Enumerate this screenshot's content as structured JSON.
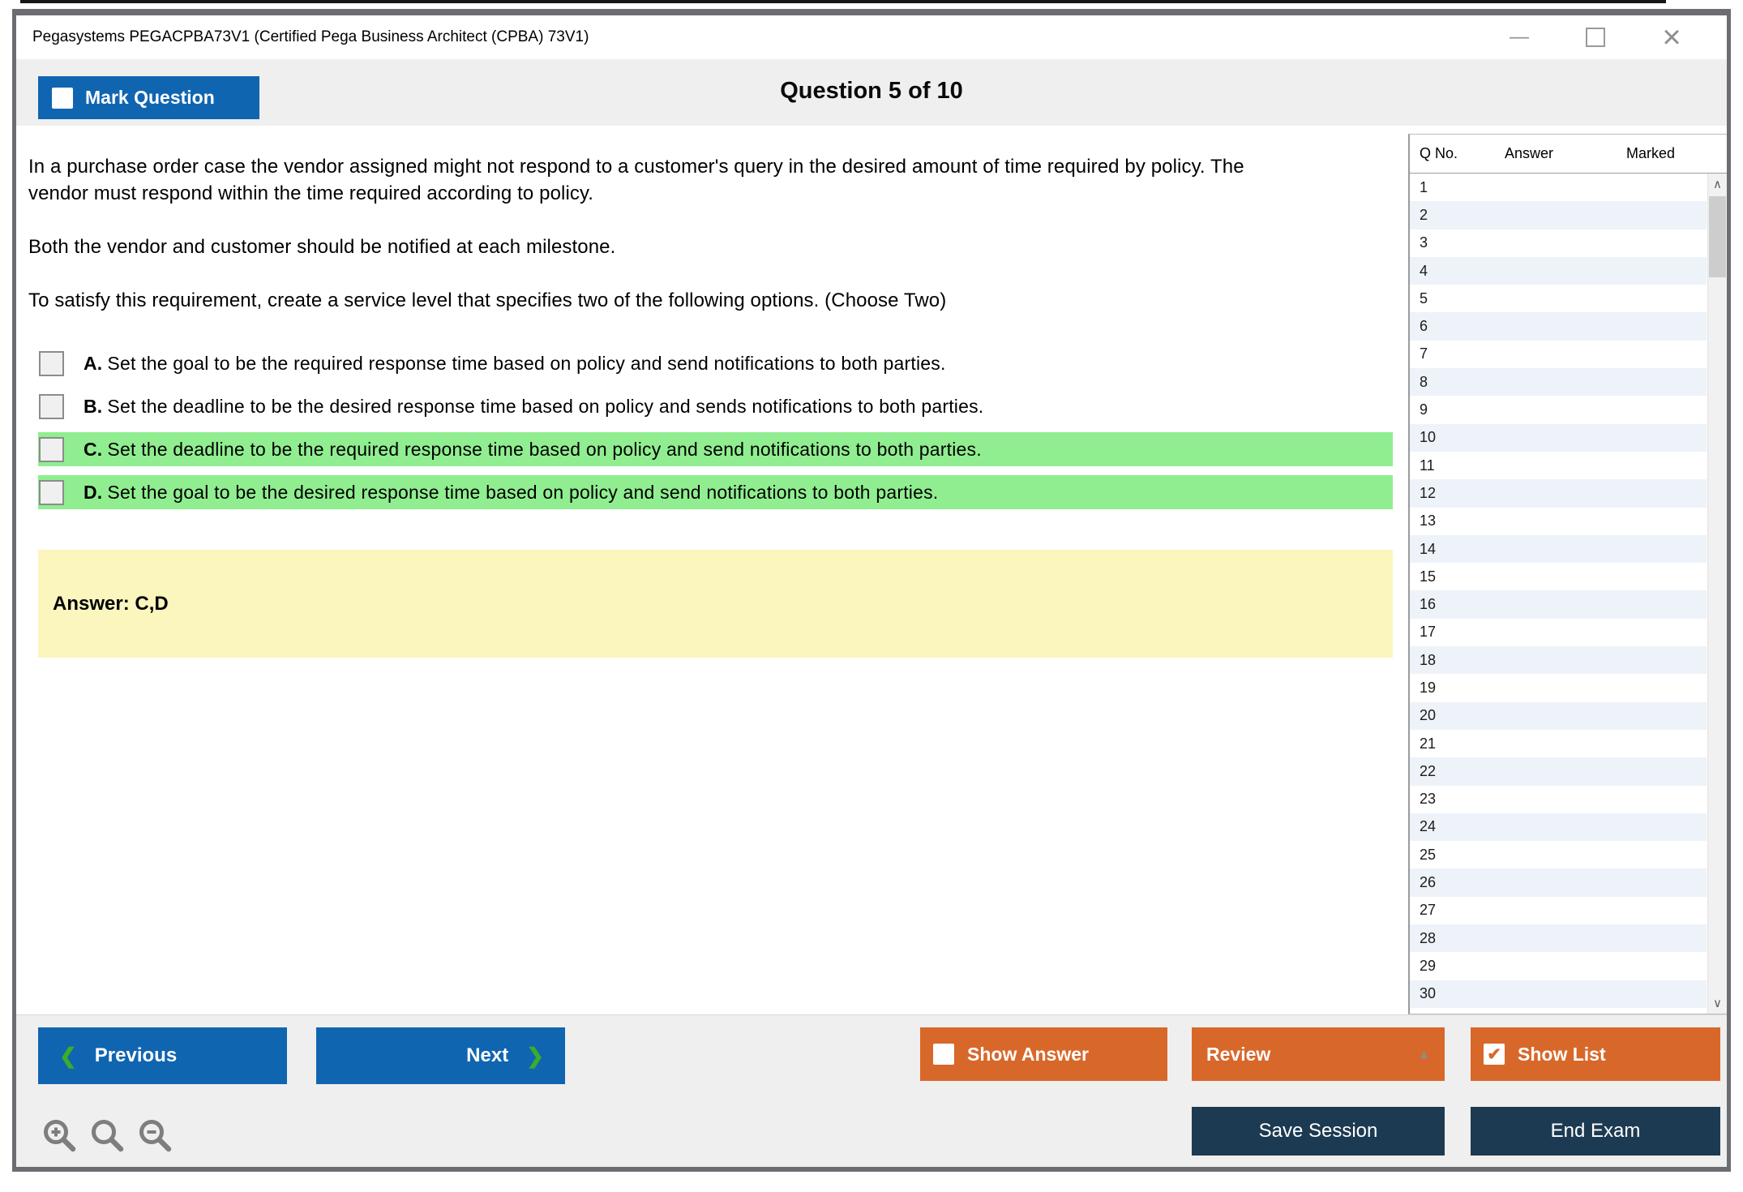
{
  "window": {
    "title": "Pegasystems PEGACPBA73V1 (Certified Pega Business Architect (CPBA) 73V1)"
  },
  "icons": {
    "minimize": "—",
    "close": "×",
    "prev_chevron": "❮",
    "next_chevron": "❯",
    "review_caret": "▲",
    "show_list_check": "✔",
    "scroll_up": "∧",
    "scroll_down": "∨"
  },
  "header": {
    "mark_question_label": "Mark Question",
    "question_counter": "Question 5 of 10"
  },
  "question": {
    "paragraphs": [
      "In a purchase order case the vendor assigned might not respond to a customer's query in the desired amount of time required by policy. The vendor must respond within the time required according to policy.",
      "Both the vendor and customer should be notified at each milestone.",
      "To satisfy this requirement, create a service level that specifies two of the following options. (Choose Two)"
    ],
    "options": [
      {
        "letter": "A.",
        "text": "Set the goal to be the required response time based on policy and send notifications to both parties.",
        "highlighted": false
      },
      {
        "letter": "B.",
        "text": "Set the deadline to be the desired response time based on policy and sends notifications to both parties.",
        "highlighted": false
      },
      {
        "letter": "C.",
        "text": "Set the deadline to be the required response time based on policy and send notifications to both parties.",
        "highlighted": true
      },
      {
        "letter": "D.",
        "text": "Set the goal to be the desired response time based on policy and send notifications to both parties.",
        "highlighted": true
      }
    ],
    "answer_label": "Answer: C,D"
  },
  "sidebar": {
    "columns": [
      "Q No.",
      "Answer",
      "Marked"
    ],
    "rows": [
      {
        "q": "1",
        "answer": "",
        "marked": ""
      },
      {
        "q": "2",
        "answer": "",
        "marked": ""
      },
      {
        "q": "3",
        "answer": "",
        "marked": ""
      },
      {
        "q": "4",
        "answer": "",
        "marked": ""
      },
      {
        "q": "5",
        "answer": "",
        "marked": ""
      },
      {
        "q": "6",
        "answer": "",
        "marked": ""
      },
      {
        "q": "7",
        "answer": "",
        "marked": ""
      },
      {
        "q": "8",
        "answer": "",
        "marked": ""
      },
      {
        "q": "9",
        "answer": "",
        "marked": ""
      },
      {
        "q": "10",
        "answer": "",
        "marked": ""
      },
      {
        "q": "11",
        "answer": "",
        "marked": ""
      },
      {
        "q": "12",
        "answer": "",
        "marked": ""
      },
      {
        "q": "13",
        "answer": "",
        "marked": ""
      },
      {
        "q": "14",
        "answer": "",
        "marked": ""
      },
      {
        "q": "15",
        "answer": "",
        "marked": ""
      },
      {
        "q": "16",
        "answer": "",
        "marked": ""
      },
      {
        "q": "17",
        "answer": "",
        "marked": ""
      },
      {
        "q": "18",
        "answer": "",
        "marked": ""
      },
      {
        "q": "19",
        "answer": "",
        "marked": ""
      },
      {
        "q": "20",
        "answer": "",
        "marked": ""
      },
      {
        "q": "21",
        "answer": "",
        "marked": ""
      },
      {
        "q": "22",
        "answer": "",
        "marked": ""
      },
      {
        "q": "23",
        "answer": "",
        "marked": ""
      },
      {
        "q": "24",
        "answer": "",
        "marked": ""
      },
      {
        "q": "25",
        "answer": "",
        "marked": ""
      },
      {
        "q": "26",
        "answer": "",
        "marked": ""
      },
      {
        "q": "27",
        "answer": "",
        "marked": ""
      },
      {
        "q": "28",
        "answer": "",
        "marked": ""
      },
      {
        "q": "29",
        "answer": "",
        "marked": ""
      },
      {
        "q": "30",
        "answer": "",
        "marked": ""
      }
    ]
  },
  "footer": {
    "previous_label": "Previous",
    "next_label": "Next",
    "show_answer_label": "Show Answer",
    "review_label": "Review",
    "show_list_label": "Show List",
    "save_session_label": "Save Session",
    "end_exam_label": "End Exam"
  },
  "colors": {
    "accent_blue": "#1065B1",
    "accent_orange": "#D8682A",
    "accent_navy": "#1C3A52",
    "highlight_green": "#90EE90",
    "answer_yellow": "#FBF5BE",
    "chevron_green": "#3BAD28",
    "toolbar_gray": "#EFEFEF",
    "alt_row_blue": "#EDF3F9"
  }
}
